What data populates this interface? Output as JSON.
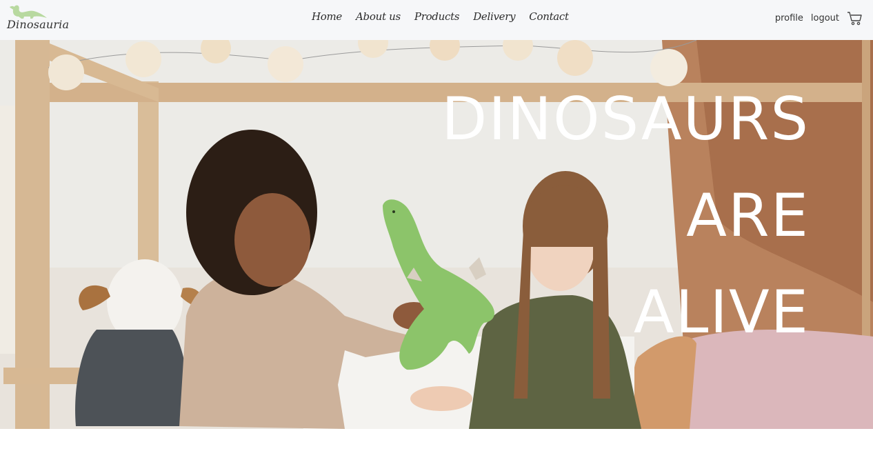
{
  "brand": {
    "name": "Dinosauria",
    "logo_icon": "dinosaur-icon",
    "logo_color": "#b8d9a0"
  },
  "nav": {
    "items": [
      {
        "label": "Home"
      },
      {
        "label": "About us"
      },
      {
        "label": "Products"
      },
      {
        "label": "Delivery"
      },
      {
        "label": "Contact"
      }
    ]
  },
  "account": {
    "profile_label": "profile",
    "logout_label": "logout",
    "cart_icon": "cart-icon"
  },
  "hero": {
    "headline_lines": [
      "DINOSAURS",
      "ARE",
      "ALIVE"
    ],
    "image": "photo-of-two-children-playing-with-green-toy-dinosaur"
  },
  "colors": {
    "header_bg": "#f6f7f9",
    "headline": "#ffffff",
    "toy_green": "#8cc46a"
  }
}
